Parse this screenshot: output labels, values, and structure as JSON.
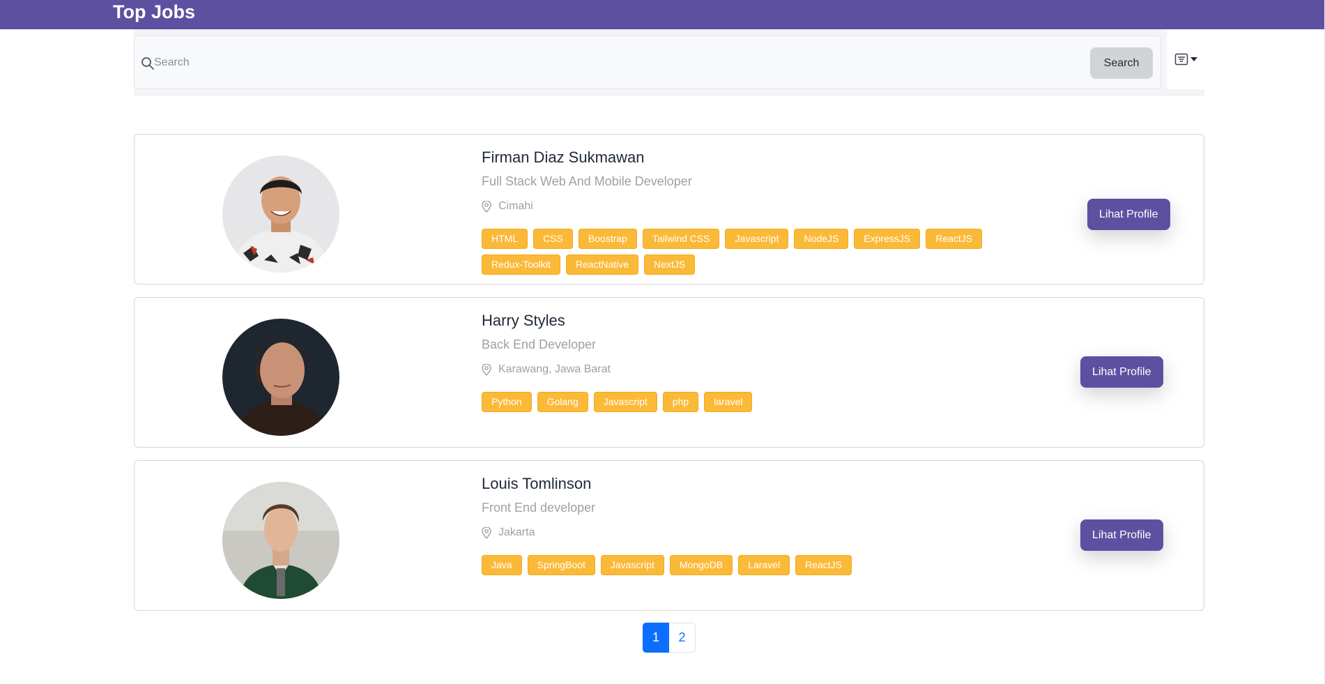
{
  "header": {
    "title": "Top Jobs"
  },
  "search": {
    "placeholder": "Search",
    "button_label": "Search"
  },
  "filter": {
    "icon": "filter-list-icon"
  },
  "workers": [
    {
      "name": "Firman Diaz Sukmawan",
      "role": "Full Stack Web And Mobile Developer",
      "location": "Cimahi",
      "skills": [
        "HTML",
        "CSS",
        "Boostrap",
        "Tailwind CSS",
        "Javascript",
        "NodeJS",
        "ExpressJS",
        "ReactJS",
        "Redux-Toolkit",
        "ReactNative",
        "NextJS"
      ],
      "button_label": "Lihat Profile"
    },
    {
      "name": "Harry Styles",
      "role": "Back End Developer",
      "location": "Karawang, Jawa Barat",
      "skills": [
        "Python",
        "Golang",
        "Javascript",
        "php",
        "laravel"
      ],
      "button_label": "Lihat Profile"
    },
    {
      "name": "Louis Tomlinson",
      "role": "Front End developer",
      "location": "Jakarta",
      "skills": [
        "Java",
        "SpringBoot",
        "Javascript",
        "MongoDB",
        "Laravel",
        "ReactJS"
      ],
      "button_label": "Lihat Profile"
    }
  ],
  "pagination": {
    "pages": [
      "1",
      "2"
    ],
    "current": "1"
  },
  "colors": {
    "brand": "#5e50a1",
    "skill_chip": "#fbb938",
    "page_active": "#0d6efd"
  }
}
